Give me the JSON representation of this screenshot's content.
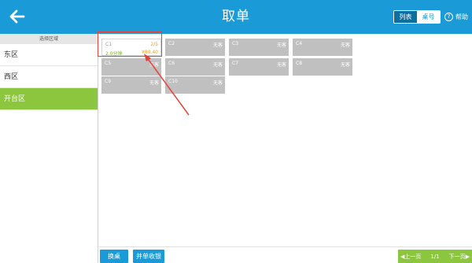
{
  "header": {
    "title": "取单",
    "back_icon": "arrow-left-icon",
    "view_toggle": {
      "list_label": "列表",
      "table_label": "桌号",
      "active": "列表"
    },
    "help_label": "帮助",
    "help_icon_glyph": "?",
    "bg_color": "#1a9bd7"
  },
  "sidebar": {
    "heading": "选择区域",
    "items": [
      {
        "label": "东区",
        "active": false
      },
      {
        "label": "西区",
        "active": false
      },
      {
        "label": "开台区",
        "active": true
      }
    ],
    "active_color": "#8cc63f"
  },
  "tables": [
    {
      "name": "C1",
      "status": "2/5",
      "time": "2.0分钟",
      "amount": "¥80.40",
      "occupied": true
    },
    {
      "name": "C2",
      "status": "无客",
      "occupied": false
    },
    {
      "name": "C3",
      "status": "无客",
      "occupied": false
    },
    {
      "name": "C4",
      "status": "无客",
      "occupied": false
    },
    {
      "name": "C5",
      "status": "无客",
      "occupied": false
    },
    {
      "name": "C6",
      "status": "无客",
      "occupied": false
    },
    {
      "name": "C7",
      "status": "无客",
      "occupied": false
    },
    {
      "name": "C8",
      "status": "无客",
      "occupied": false
    },
    {
      "name": "C9",
      "status": "无客",
      "occupied": false
    },
    {
      "name": "C10",
      "status": "无客",
      "occupied": false
    }
  ],
  "footer": {
    "switch_table": "换桌",
    "merge_checkout": "并单收银",
    "prev_page": "◀上一页",
    "page_indicator": "1/1",
    "next_page": "下一页▶"
  }
}
